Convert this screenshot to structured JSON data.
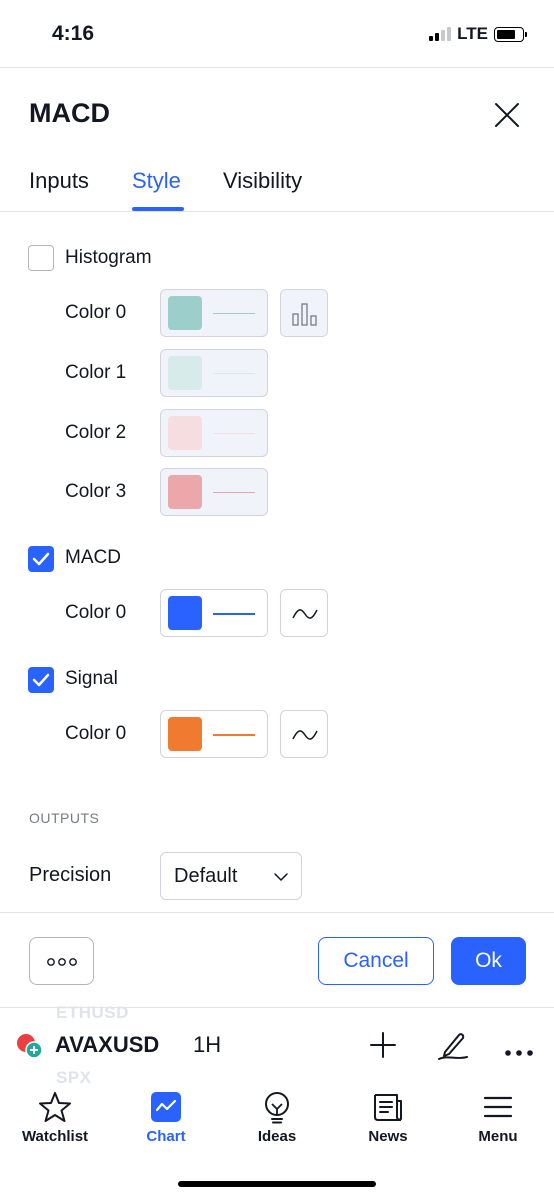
{
  "status_bar": {
    "time": "4:16",
    "network": "LTE"
  },
  "dialog": {
    "title": "MACD",
    "tabs": [
      {
        "label": "Inputs",
        "active": false
      },
      {
        "label": "Style",
        "active": true
      },
      {
        "label": "Visibility",
        "active": false
      }
    ],
    "histogram": {
      "label": "Histogram",
      "checked": false,
      "colors": [
        {
          "label": "Color 0",
          "color": "#9ccfcc"
        },
        {
          "label": "Color 1",
          "color": "#d6ebea"
        },
        {
          "label": "Color 2",
          "color": "#f5dde0"
        },
        {
          "label": "Color 3",
          "color": "#eba7a9"
        }
      ]
    },
    "macd": {
      "label": "MACD",
      "checked": true,
      "color_label": "Color 0",
      "color": "#2962ff"
    },
    "signal": {
      "label": "Signal",
      "checked": true,
      "color_label": "Color 0",
      "color": "#f07a2f"
    },
    "outputs": {
      "section_label": "OUTPUTS",
      "precision_label": "Precision",
      "precision_value": "Default"
    },
    "buttons": {
      "cancel": "Cancel",
      "ok": "Ok"
    }
  },
  "chart_bar": {
    "symbol": "AVAXUSD",
    "interval": "1H",
    "ghost_above": "ETHUSD",
    "ghost_below": "SPX"
  },
  "bottom_nav": [
    {
      "label": "Watchlist",
      "icon": "star-icon",
      "active": false
    },
    {
      "label": "Chart",
      "icon": "chart-icon",
      "active": true
    },
    {
      "label": "Ideas",
      "icon": "lightbulb-icon",
      "active": false
    },
    {
      "label": "News",
      "icon": "newspaper-icon",
      "active": false
    },
    {
      "label": "Menu",
      "icon": "hamburger-icon",
      "active": false
    }
  ],
  "colors": {
    "accent": "#2962ff",
    "border": "#d1d4dc",
    "text": "#131722"
  }
}
